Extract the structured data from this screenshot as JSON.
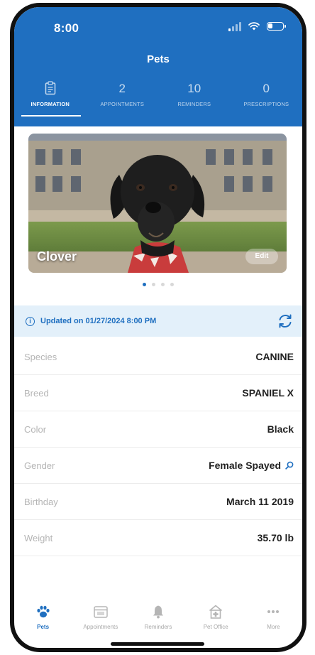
{
  "status_bar": {
    "time": "8:00"
  },
  "header": {
    "title": "Pets"
  },
  "tabs": [
    {
      "count": "",
      "label": "INFORMATION",
      "active": true
    },
    {
      "count": "2",
      "label": "APPOINTMENTS"
    },
    {
      "count": "10",
      "label": "REMINDERS"
    },
    {
      "count": "0",
      "label": "PRESCRIPTIONS"
    }
  ],
  "pet": {
    "name": "Clover",
    "edit_label": "Edit"
  },
  "carousel": {
    "total": 4,
    "active_index": 0
  },
  "updated": {
    "text": "Updated on 01/27/2024 8:00 PM"
  },
  "info_rows": [
    {
      "label": "Species",
      "value": "CANINE"
    },
    {
      "label": "Breed",
      "value": "SPANIEL X"
    },
    {
      "label": "Color",
      "value": "Black"
    },
    {
      "label": "Gender",
      "value": "Female Spayed"
    },
    {
      "label": "Birthday",
      "value": "March 11 2019"
    },
    {
      "label": "Weight",
      "value": "35.70 lb"
    }
  ],
  "bottom_nav": [
    {
      "label": "Pets",
      "icon": "paw-icon",
      "active": true
    },
    {
      "label": "Appointments",
      "icon": "calendar-icon"
    },
    {
      "label": "Reminders",
      "icon": "bell-icon"
    },
    {
      "label": "Pet Office",
      "icon": "building-icon"
    },
    {
      "label": "More",
      "icon": "more-dots-icon"
    }
  ],
  "colors": {
    "primary": "#1f6fc0",
    "info_bg": "#e3f0fa"
  }
}
